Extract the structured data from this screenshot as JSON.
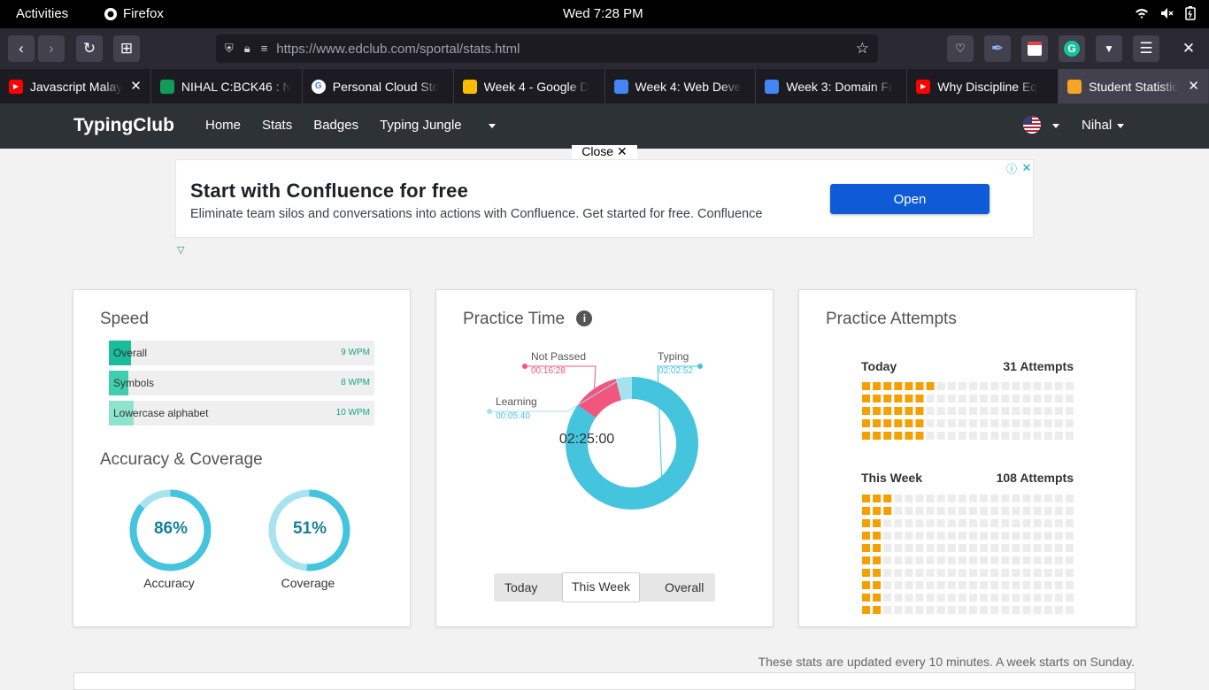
{
  "system_bar": {
    "activities": "Activities",
    "app_name": "Firefox",
    "clock": "Wed  7:28 PM"
  },
  "browser": {
    "url_host": "https://www.edclub.com",
    "url_path": "/sportal/stats.html",
    "tabs": [
      {
        "title": "Javascript Malay",
        "favicon": "youtube-icon",
        "color": "#ff0000",
        "active": false
      },
      {
        "title": "NIHAL C:BCK46 : N",
        "favicon": "sheets-icon",
        "color": "#0f9d58",
        "active": false
      },
      {
        "title": "Personal Cloud Sto",
        "favicon": "google-icon",
        "color": "#ffffff",
        "active": false
      },
      {
        "title": "Week 4 - Google D",
        "favicon": "drive-icon",
        "color": "#fbbc04",
        "active": false
      },
      {
        "title": "Week 4: Web Deve",
        "favicon": "docs-icon",
        "color": "#4285f4",
        "active": false
      },
      {
        "title": "Week 3: Domain Fr",
        "favicon": "docs-icon",
        "color": "#4285f4",
        "active": false
      },
      {
        "title": "Why Discipline Eq",
        "favicon": "youtube-icon",
        "color": "#ff0000",
        "active": false
      },
      {
        "title": "Student Statistic",
        "favicon": "typingclub-icon",
        "color": "#f5a623",
        "active": true
      }
    ]
  },
  "site_nav": {
    "brand": "TypingClub",
    "links": [
      "Home",
      "Stats",
      "Badges",
      "Typing Jungle"
    ],
    "user": "Nihal"
  },
  "ad": {
    "close_label": "Close",
    "title": "Start with Confluence for free",
    "description": "Eliminate team silos and conversations into actions with Confluence. Get started for free. Confluence",
    "cta": "Open"
  },
  "speed_card": {
    "title": "Speed",
    "rows": [
      {
        "label": "Overall",
        "value": "9 WPM",
        "wpm": 9
      },
      {
        "label": "Symbols",
        "value": "8 WPM",
        "wpm": 8
      },
      {
        "label": "Lowercase alphabet",
        "value": "10 WPM",
        "wpm": 10
      }
    ],
    "accuracy_title": "Accuracy & Coverage",
    "accuracy": {
      "label": "Accuracy",
      "value": "86%",
      "percent": 86
    },
    "coverage": {
      "label": "Coverage",
      "value": "51%",
      "percent": 51
    }
  },
  "practice_card": {
    "title": "Practice Time",
    "total": "02:25:00",
    "segments": [
      {
        "label": "Typing",
        "time": "02:02:52",
        "color": "#45c4dd"
      },
      {
        "label": "Not Passed",
        "time": "00:16:28",
        "color": "#f0567e"
      },
      {
        "label": "Learning",
        "time": "00:05:40",
        "color": "#a3e2ee"
      }
    ],
    "range_options": [
      "Today",
      "This Week",
      "Overall"
    ],
    "selected_range": "This Week"
  },
  "attempts_card": {
    "title": "Practice Attempts",
    "today": {
      "label": "Today",
      "count": "31 Attempts",
      "attempts": 31
    },
    "week": {
      "label": "This Week",
      "count": "108 Attempts",
      "attempts": 108
    }
  },
  "footer_note": "These stats are updated every 10 minutes. A week starts on Sunday.",
  "colors": {
    "accent_teal": "#45c4dd",
    "accent_pink": "#f0567e",
    "attempt_orange": "#f5a000",
    "nav_bg": "#2d3237"
  }
}
